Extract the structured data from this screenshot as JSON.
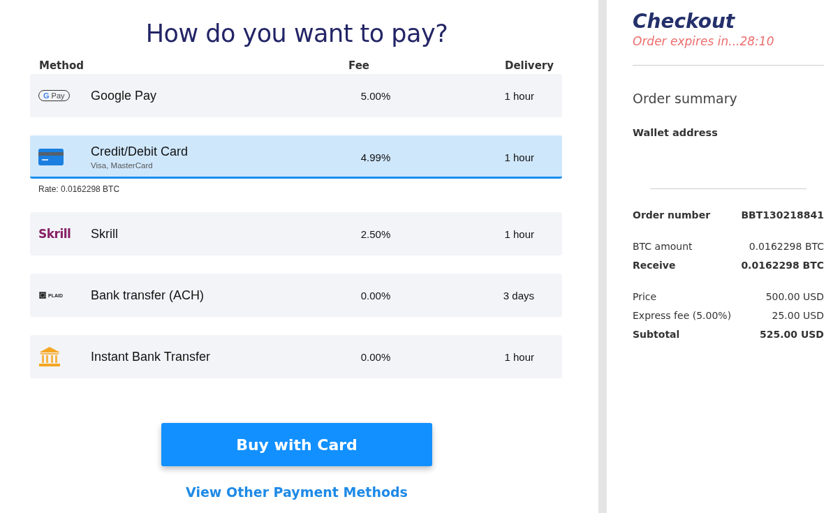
{
  "heading": "How do you want to pay?",
  "columns": [
    "Method",
    "Fee",
    "Delivery"
  ],
  "methods": [
    {
      "kind": "gpay",
      "logo_text": "Pay",
      "logo_letter": "G",
      "name": "Google Pay",
      "fee": "5.00%",
      "delivery": "1 hour",
      "selected": false
    },
    {
      "kind": "card",
      "name": "Credit/Debit Card",
      "subtitle": "Visa, MasterCard",
      "fee": "4.99%",
      "delivery": "1 hour",
      "selected": true,
      "note": "Rate: 0.0162298 BTC"
    },
    {
      "kind": "skrill",
      "logo_text": "Skrill",
      "name": "Skrill",
      "fee": "2.50%",
      "delivery": "1 hour",
      "selected": false
    },
    {
      "kind": "plaid",
      "logo_text": "PLAID",
      "name": "Bank transfer (ACH)",
      "fee": "0.00%",
      "delivery": "3 days",
      "selected": false
    },
    {
      "kind": "bank",
      "name": "Instant Bank Transfer",
      "fee": "0.00%",
      "delivery": "1 hour",
      "selected": false
    }
  ],
  "buy_button": "Buy with Card",
  "other_methods_link": "View Other Payment Methods",
  "checkout": {
    "title": "Checkout",
    "expires": "Order expires in...28:10",
    "summary_title": "Order summary",
    "wallet_label": "Wallet address",
    "groups": [
      [
        {
          "label": "Order number",
          "value": "BBT130218841",
          "bold": true
        }
      ],
      [
        {
          "label": "BTC amount",
          "value": "0.0162298 BTC",
          "bold": false
        },
        {
          "label": "Receive",
          "value": "0.0162298 BTC",
          "bold": true
        }
      ],
      [
        {
          "label": "Price",
          "value": "500.00 USD",
          "bold": false
        },
        {
          "label": "Express fee (5.00%)",
          "value": "25.00 USD",
          "bold": false
        },
        {
          "label": "Subtotal",
          "value": "525.00 USD",
          "bold": true
        }
      ]
    ]
  }
}
